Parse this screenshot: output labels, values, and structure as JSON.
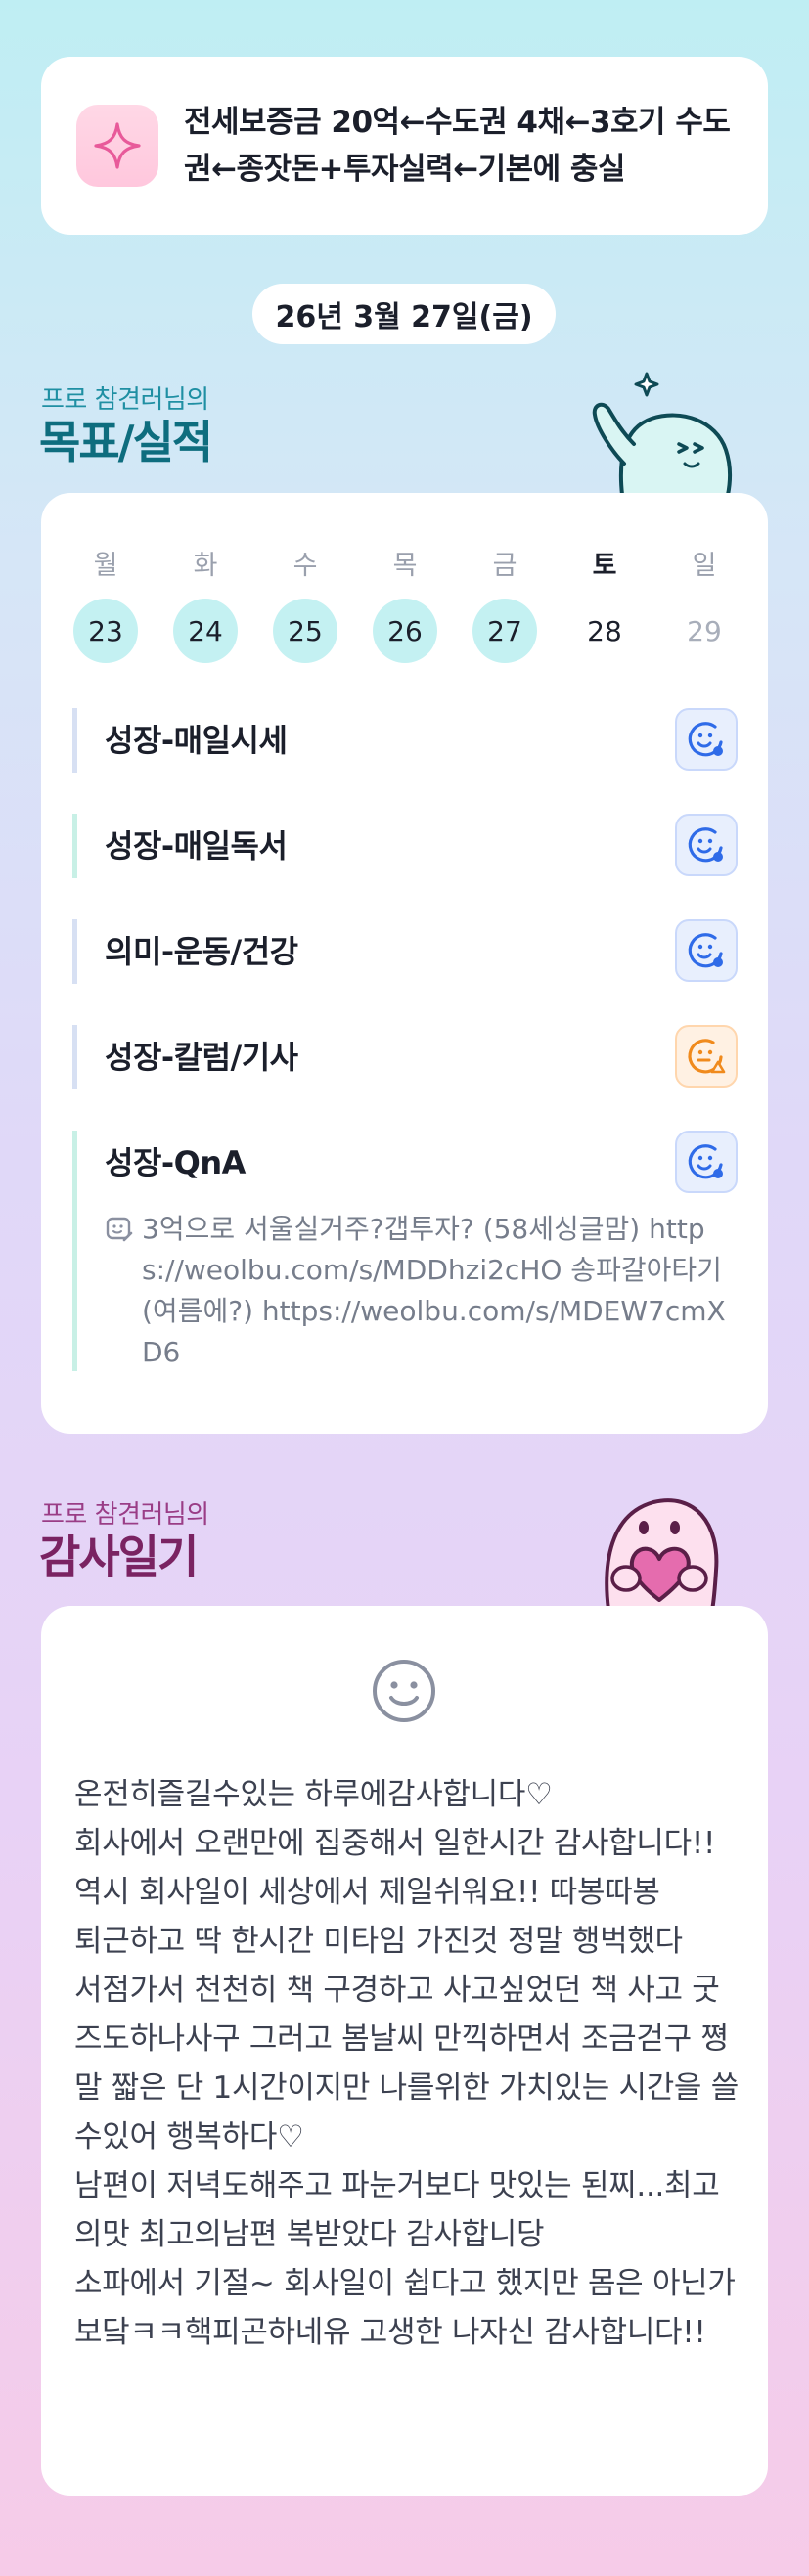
{
  "banner": {
    "goal_text": "전세보증금 20억←수도권 4채←3호기 수도권←종잣돈+투자실력←기본에 충실",
    "icon": "sparkle-icon",
    "icon_color": "#e85a9a"
  },
  "date": "26년 3월 27일(금)",
  "goals_section": {
    "subtitle": "프로 참견러님의",
    "title": "목표/실적"
  },
  "week": {
    "weekdays": [
      "월",
      "화",
      "수",
      "목",
      "금",
      "토",
      "일"
    ],
    "days": [
      {
        "num": "23",
        "done": true
      },
      {
        "num": "24",
        "done": true
      },
      {
        "num": "25",
        "done": true
      },
      {
        "num": "26",
        "done": true
      },
      {
        "num": "27",
        "done": true
      },
      {
        "num": "28",
        "done": false
      },
      {
        "num": "29",
        "done": false
      }
    ]
  },
  "goals": [
    {
      "name": "성장-매일시세",
      "status_icon": "smile-check-icon",
      "status_color": "#2f6be8"
    },
    {
      "name": "성장-매일독서",
      "status_icon": "smile-check-icon",
      "status_color": "#2f6be8"
    },
    {
      "name": "의미-운동/건강",
      "status_icon": "smile-check-icon",
      "status_color": "#2f6be8"
    },
    {
      "name": "성장-칼럼/기사",
      "status_icon": "smile-warning-icon",
      "status_color": "#f08a1c"
    },
    {
      "name": "성장-QnA",
      "status_icon": "smile-check-icon",
      "status_color": "#2f6be8",
      "note": "3억으로 서울실거주?갭투자? (58세싱글맘) https://weolbu.com/s/MDDhzi2cHO 송파갈아타기(여름에?) https://weolbu.com/s/MDEW7cmXD6"
    }
  ],
  "gratitude_section": {
    "subtitle": "프로 참견러님의",
    "title": "감사일기"
  },
  "gratitude": {
    "mood_icon": "smile-face-icon",
    "text": "온전히즐길수있는 하루에감사합니다♡\n회사에서 오랜만에 집중해서 일한시간 감사합니다!! 역시 회사일이 세상에서 제일쉬워요!! 따봉따봉\n퇴근하고 딱 한시간 미타임 가진것 정말 행벅했다\n서점가서 천천히 책 구경하고 사고싶었던 책 사고 굿즈도하나사구 그러고 봄날씨 만끽하면서 조금걷구 쪙말 짧은 단 1시간이지만 나를위한 가치있는 시간을 쓸수있어 행복하다♡\n남편이 저녁도해주고 파눈거보다 맛있는 된찌...최고의맛 최고의남편 복받았다 감사합니당\n소파에서 기절~ 회사일이 쉽다고 했지만 몸은 아닌가보닼ㅋㅋ핵피곤하네유 고생한 나자신 감사합니다!!"
  }
}
